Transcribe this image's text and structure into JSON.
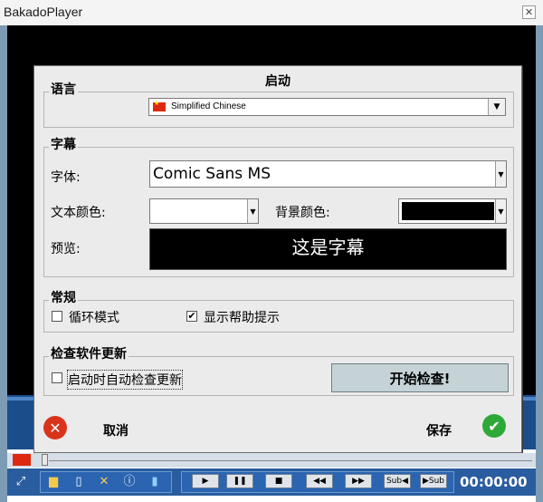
{
  "window": {
    "title": "BakadoPlayer",
    "close_glyph": "✕"
  },
  "dialog": {
    "title": "启动",
    "language": {
      "label": "语言",
      "selected": "Simplified Chinese",
      "flag_color": "#de2910"
    },
    "subtitle": {
      "label": "字幕",
      "font_label": "字体:",
      "font_value": "Comic Sans MS",
      "text_color_label": "文本颜色:",
      "text_color_value": "#ffffff",
      "bg_color_label": "背景颜色:",
      "bg_color_value": "#000000",
      "preview_label": "预览:",
      "preview_text": "这是字幕"
    },
    "general": {
      "label": "常规",
      "loop_mode": {
        "label": "循环模式",
        "checked": false
      },
      "show_help": {
        "label": "显示帮助提示",
        "checked": true
      }
    },
    "updates": {
      "label": "检查软件更新",
      "auto_check": {
        "label": "启动时自动检查更新",
        "checked": false
      },
      "check_button": "开始检查!"
    },
    "cancel_label": "取消",
    "save_label": "保存"
  },
  "controls": {
    "play": "▶",
    "pause": "❚❚",
    "stop": "■",
    "rewind": "◀◀",
    "forward": "▶▶",
    "sub_prev": "Sub◀",
    "sub_next": "▶Sub",
    "time": "00:00:00"
  },
  "colors": {
    "dialog_bg": "#ebebeb",
    "toolbar_bg": "#2a5d9f",
    "cancel_icon": "#d9331c",
    "save_icon": "#2fa83a"
  }
}
